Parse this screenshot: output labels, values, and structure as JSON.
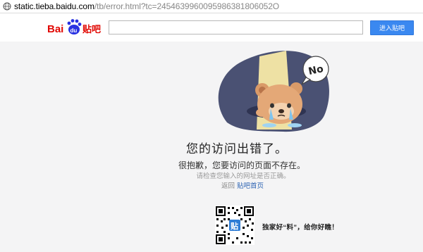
{
  "browser": {
    "url_host": "static.tieba.baidu.com",
    "url_rest": "/tb/error.html?tc=2454639960095986381806052O"
  },
  "header": {
    "logo_text_bai": "Bai",
    "logo_text_du": "du",
    "logo_text_tieba": "贴吧",
    "search_value": "",
    "enter_button": "进入贴吧"
  },
  "error": {
    "bubble_text": "No",
    "title": "您的访问出错了。",
    "subtitle": "很抱歉，您要访问的页面不存在。",
    "hint": "请检查您输入的网址是否正确。",
    "back_prefix": "返回",
    "back_link": "贴吧首页"
  },
  "promo": {
    "qr_badge": "贴",
    "text": "独家好“料”，给你好瞧！"
  },
  "colors": {
    "accent_blue": "#3a88f0",
    "baidu_red": "#e10601",
    "baidu_blue": "#2932e1",
    "page_bg": "#f4f4f5"
  }
}
